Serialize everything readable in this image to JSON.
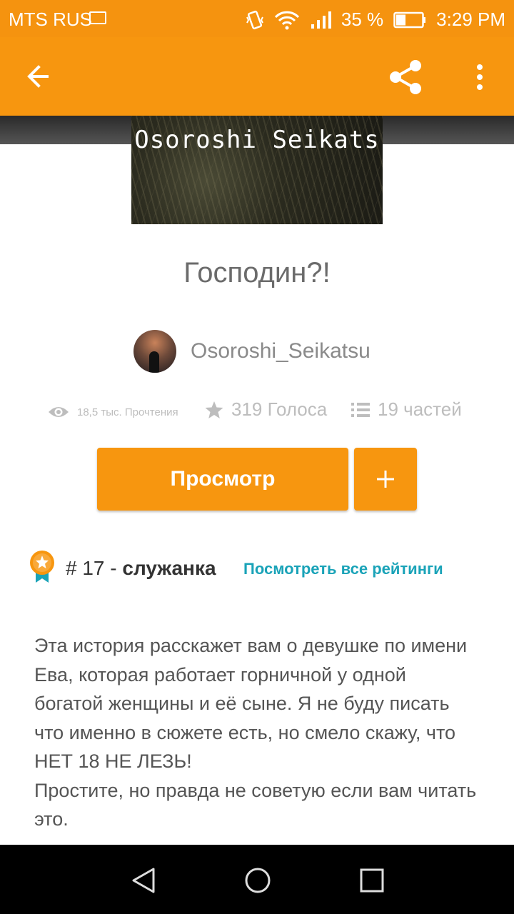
{
  "status_bar": {
    "carrier": "MTS RUS",
    "battery": "35 %",
    "time": "3:29 PM"
  },
  "app_bar": {
    "back_icon": "arrow-left-icon",
    "share_icon": "share-icon",
    "menu_icon": "more-vert-icon"
  },
  "cover": {
    "title_text": "Osoroshi Seikats"
  },
  "story": {
    "title": "Господин?!",
    "author": "Osoroshi_Seikatsu"
  },
  "stats": {
    "reads": "18,5 тыс. Прочтения",
    "votes": "319 Голоса",
    "parts": "19 частей"
  },
  "actions": {
    "view_label": "Просмотр",
    "add_label": "+"
  },
  "ranking": {
    "rank": "# 17 - ",
    "tag": "служанка",
    "see_all": "Посмотреть все рейтинги"
  },
  "description": "Эта история расскажет вам о девушке по имени Ева, которая работает горничной у одной богатой женщины и её сыне. Я не буду писать что именно в сюжете есть, но смело скажу, что НЕТ 18 НЕ ЛЕЗЬ!\nПростите, но правда не советую если вам читать это.",
  "colors": {
    "accent": "#f7960f",
    "link": "#1aa3b8"
  }
}
